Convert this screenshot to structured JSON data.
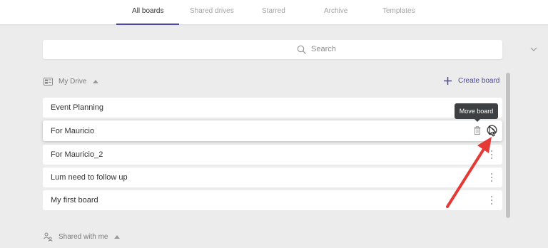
{
  "tabs": [
    {
      "label": "All boards",
      "active": true
    },
    {
      "label": "Shared drives",
      "active": false
    },
    {
      "label": "Starred",
      "active": false
    },
    {
      "label": "Archive",
      "active": false
    },
    {
      "label": "Templates",
      "active": false
    }
  ],
  "search": {
    "label": "Search"
  },
  "my_drive": {
    "label": "My Drive"
  },
  "create_board": {
    "label": "Create board"
  },
  "boards": [
    {
      "name": "Event Planning"
    },
    {
      "name": "For Mauricio",
      "hovered": true
    },
    {
      "name": "For Mauricio_2"
    },
    {
      "name": "Lum need to follow up"
    },
    {
      "name": "My first board"
    }
  ],
  "tooltip": {
    "text": "Move board"
  },
  "shared": {
    "label": "Shared with me"
  },
  "colors": {
    "accent": "#4a48a0",
    "annotation": "#e53935",
    "tooltip_bg": "#3c4043",
    "background": "#ececec"
  },
  "icons": {
    "search": "search-icon",
    "expand": "chevron-down-icon",
    "drive": "drive-icon",
    "collapse": "caret-up-icon",
    "create": "plus-icon",
    "more": "kebab-icon",
    "delete": "trash-icon",
    "move": "move-board-icon",
    "shared": "shared-people-icon",
    "pointer": "cursor-icon"
  }
}
